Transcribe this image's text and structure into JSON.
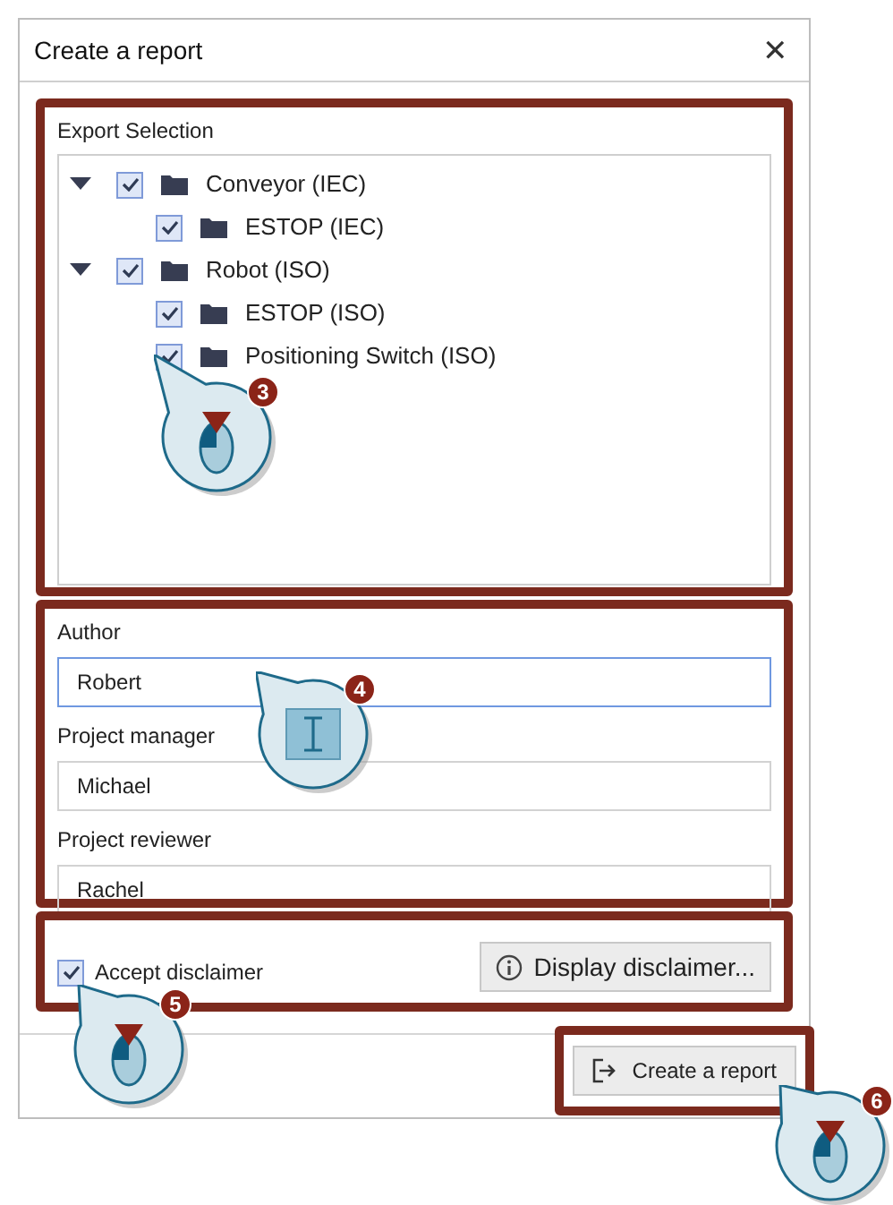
{
  "window": {
    "title": "Create a report",
    "close": "✕"
  },
  "export_selection": {
    "label": "Export Selection",
    "tree": [
      {
        "label": "Conveyor (IEC)",
        "checked": true,
        "expanded": true,
        "children": [
          {
            "label": "ESTOP (IEC)",
            "checked": true
          }
        ]
      },
      {
        "label": "Robot (ISO)",
        "checked": true,
        "expanded": true,
        "children": [
          {
            "label": "ESTOP (ISO)",
            "checked": true
          },
          {
            "label": "Positioning Switch (ISO)",
            "checked": true
          }
        ]
      }
    ]
  },
  "fields": [
    {
      "label": "Author",
      "value": "Robert",
      "focused": true
    },
    {
      "label": "Project manager",
      "value": "Michael",
      "focused": false
    },
    {
      "label": "Project reviewer",
      "value": "Rachel",
      "focused": false
    }
  ],
  "disclaimer": {
    "label": "Accept disclaimer",
    "checked": true,
    "button": "Display disclaimer..."
  },
  "create_button": "Create a report",
  "callouts": [
    {
      "number": "3",
      "kind": "mouse"
    },
    {
      "number": "4",
      "kind": "text"
    },
    {
      "number": "5",
      "kind": "mouse"
    },
    {
      "number": "6",
      "kind": "mouse"
    }
  ]
}
